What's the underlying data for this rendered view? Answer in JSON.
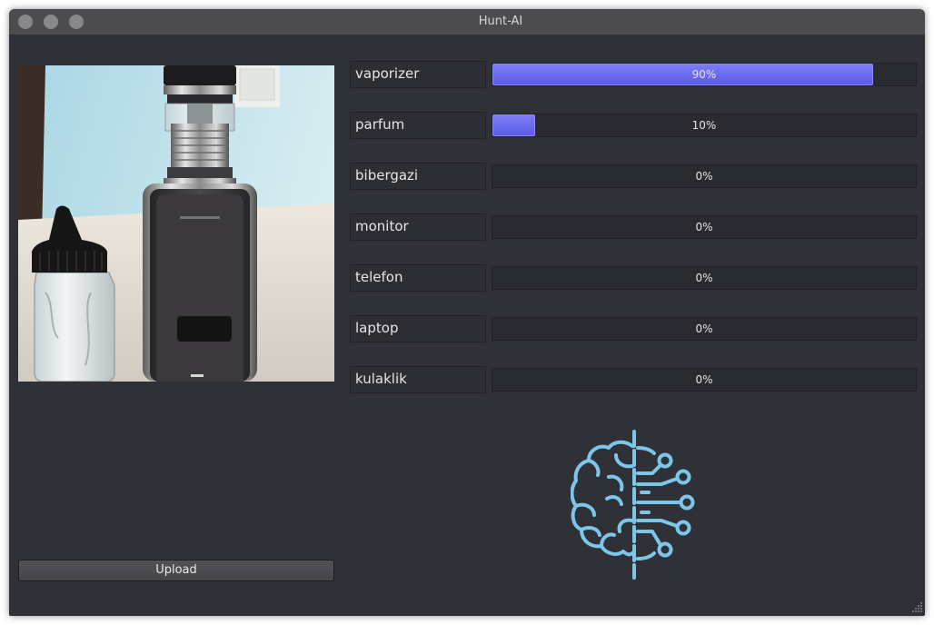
{
  "window": {
    "title": "Hunt-AI",
    "controls": [
      "close-icon",
      "minimize-icon",
      "maximize-icon"
    ]
  },
  "predictions": [
    {
      "label": "vaporizer",
      "percent": 90,
      "text": "90%"
    },
    {
      "label": "parfum",
      "percent": 10,
      "text": "10%"
    },
    {
      "label": "bibergazi",
      "percent": 0,
      "text": "0%"
    },
    {
      "label": "monitor",
      "percent": 0,
      "text": "0%"
    },
    {
      "label": "telefon",
      "percent": 0,
      "text": "0%"
    },
    {
      "label": "laptop",
      "percent": 0,
      "text": "0%"
    },
    {
      "label": "kulaklik",
      "percent": 0,
      "text": "0%"
    }
  ],
  "upload": {
    "label": "Upload"
  },
  "logo": {
    "icon": "brain-circuit-icon"
  },
  "colors": {
    "window_bg": "#303037",
    "titlebar_bg": "#4b4b50",
    "progress_fill_top": "#7c7cf6",
    "progress_fill_bottom": "#5c5ce8",
    "logo": "#7cc6ea"
  }
}
